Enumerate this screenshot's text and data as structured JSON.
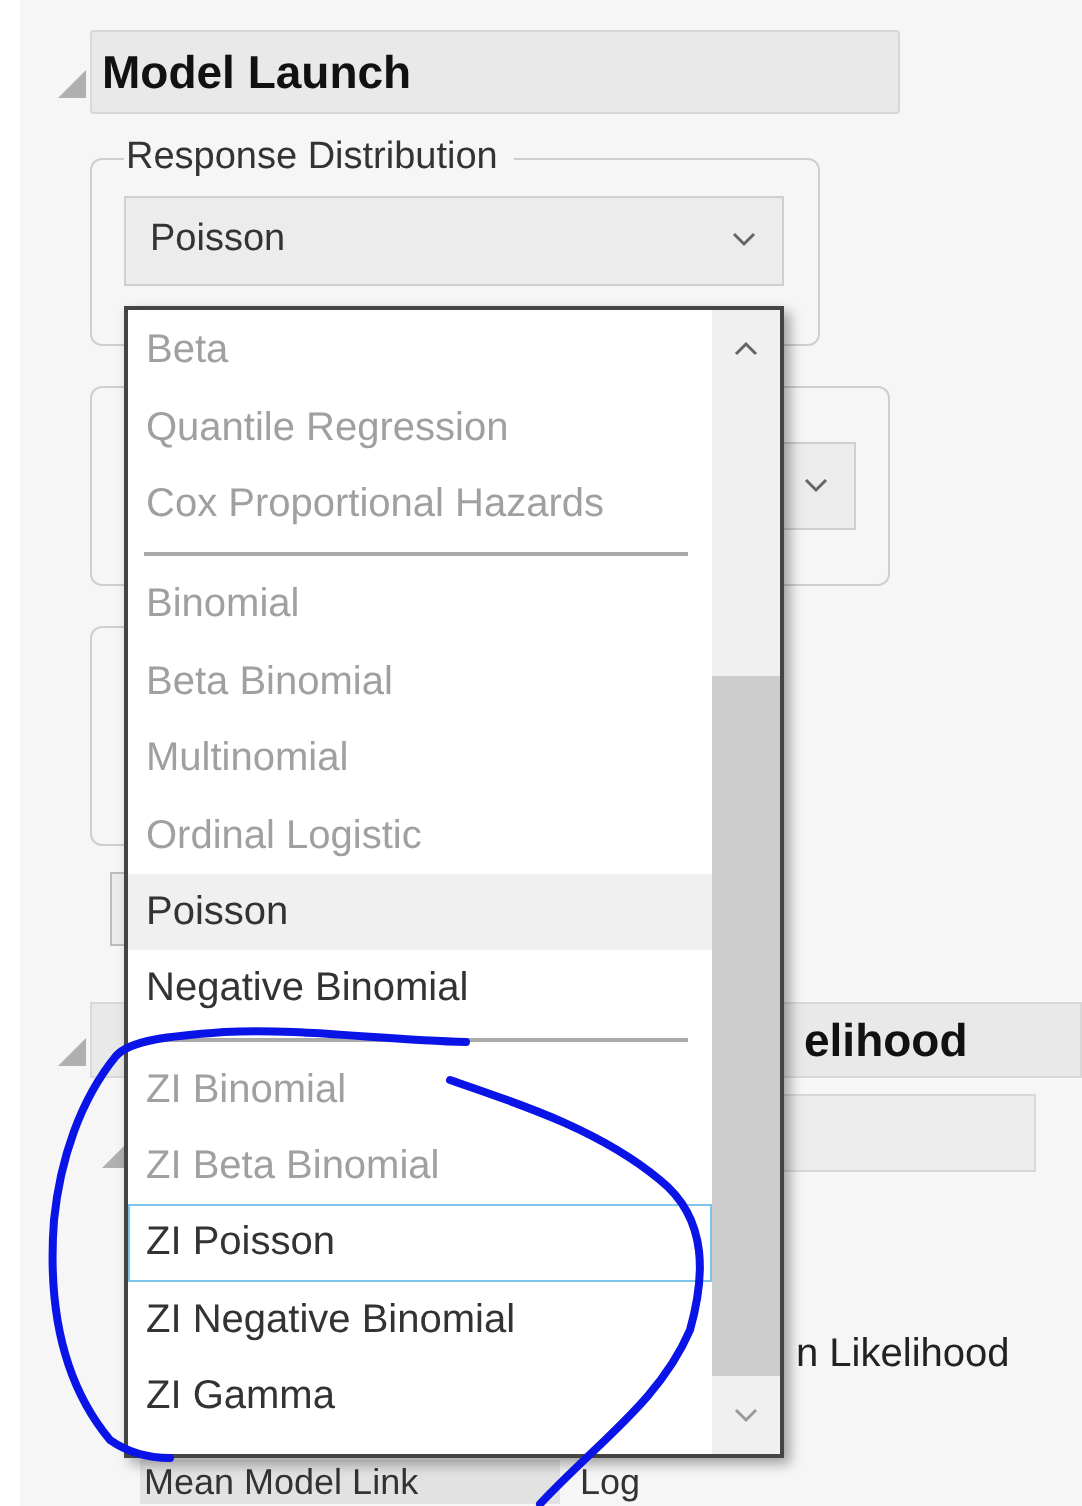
{
  "section": {
    "title": "Model Launch",
    "expanded": true
  },
  "response_distribution": {
    "legend": "Response Distribution",
    "value": "Poisson"
  },
  "dropdown": {
    "items": [
      {
        "kind": "item",
        "label": "Beta",
        "disabled": true,
        "selected": false,
        "focused": false
      },
      {
        "kind": "item",
        "label": "Quantile Regression",
        "disabled": true,
        "selected": false,
        "focused": false
      },
      {
        "kind": "item",
        "label": "Cox Proportional Hazards",
        "disabled": true,
        "selected": false,
        "focused": false
      },
      {
        "kind": "separator"
      },
      {
        "kind": "item",
        "label": "Binomial",
        "disabled": true,
        "selected": false,
        "focused": false
      },
      {
        "kind": "item",
        "label": "Beta Binomial",
        "disabled": true,
        "selected": false,
        "focused": false
      },
      {
        "kind": "item",
        "label": "Multinomial",
        "disabled": true,
        "selected": false,
        "focused": false
      },
      {
        "kind": "item",
        "label": "Ordinal Logistic",
        "disabled": true,
        "selected": false,
        "focused": false
      },
      {
        "kind": "item",
        "label": "Poisson",
        "disabled": false,
        "selected": true,
        "focused": false
      },
      {
        "kind": "item",
        "label": "Negative Binomial",
        "disabled": false,
        "selected": false,
        "focused": false
      },
      {
        "kind": "separator"
      },
      {
        "kind": "item",
        "label": "ZI Binomial",
        "disabled": true,
        "selected": false,
        "focused": false
      },
      {
        "kind": "item",
        "label": "ZI Beta Binomial",
        "disabled": true,
        "selected": false,
        "focused": false
      },
      {
        "kind": "item",
        "label": "ZI Poisson",
        "disabled": false,
        "selected": false,
        "focused": true
      },
      {
        "kind": "item",
        "label": "ZI Negative Binomial",
        "disabled": false,
        "selected": false,
        "focused": false
      },
      {
        "kind": "item",
        "label": "ZI Gamma",
        "disabled": false,
        "selected": false,
        "focused": false
      }
    ]
  },
  "section_2": {
    "title_fragment": "elihood",
    "expanded": true
  },
  "estimation_fragment": "n Likelihood",
  "link_row": {
    "label": "Mean Model Link",
    "value": "Log"
  }
}
